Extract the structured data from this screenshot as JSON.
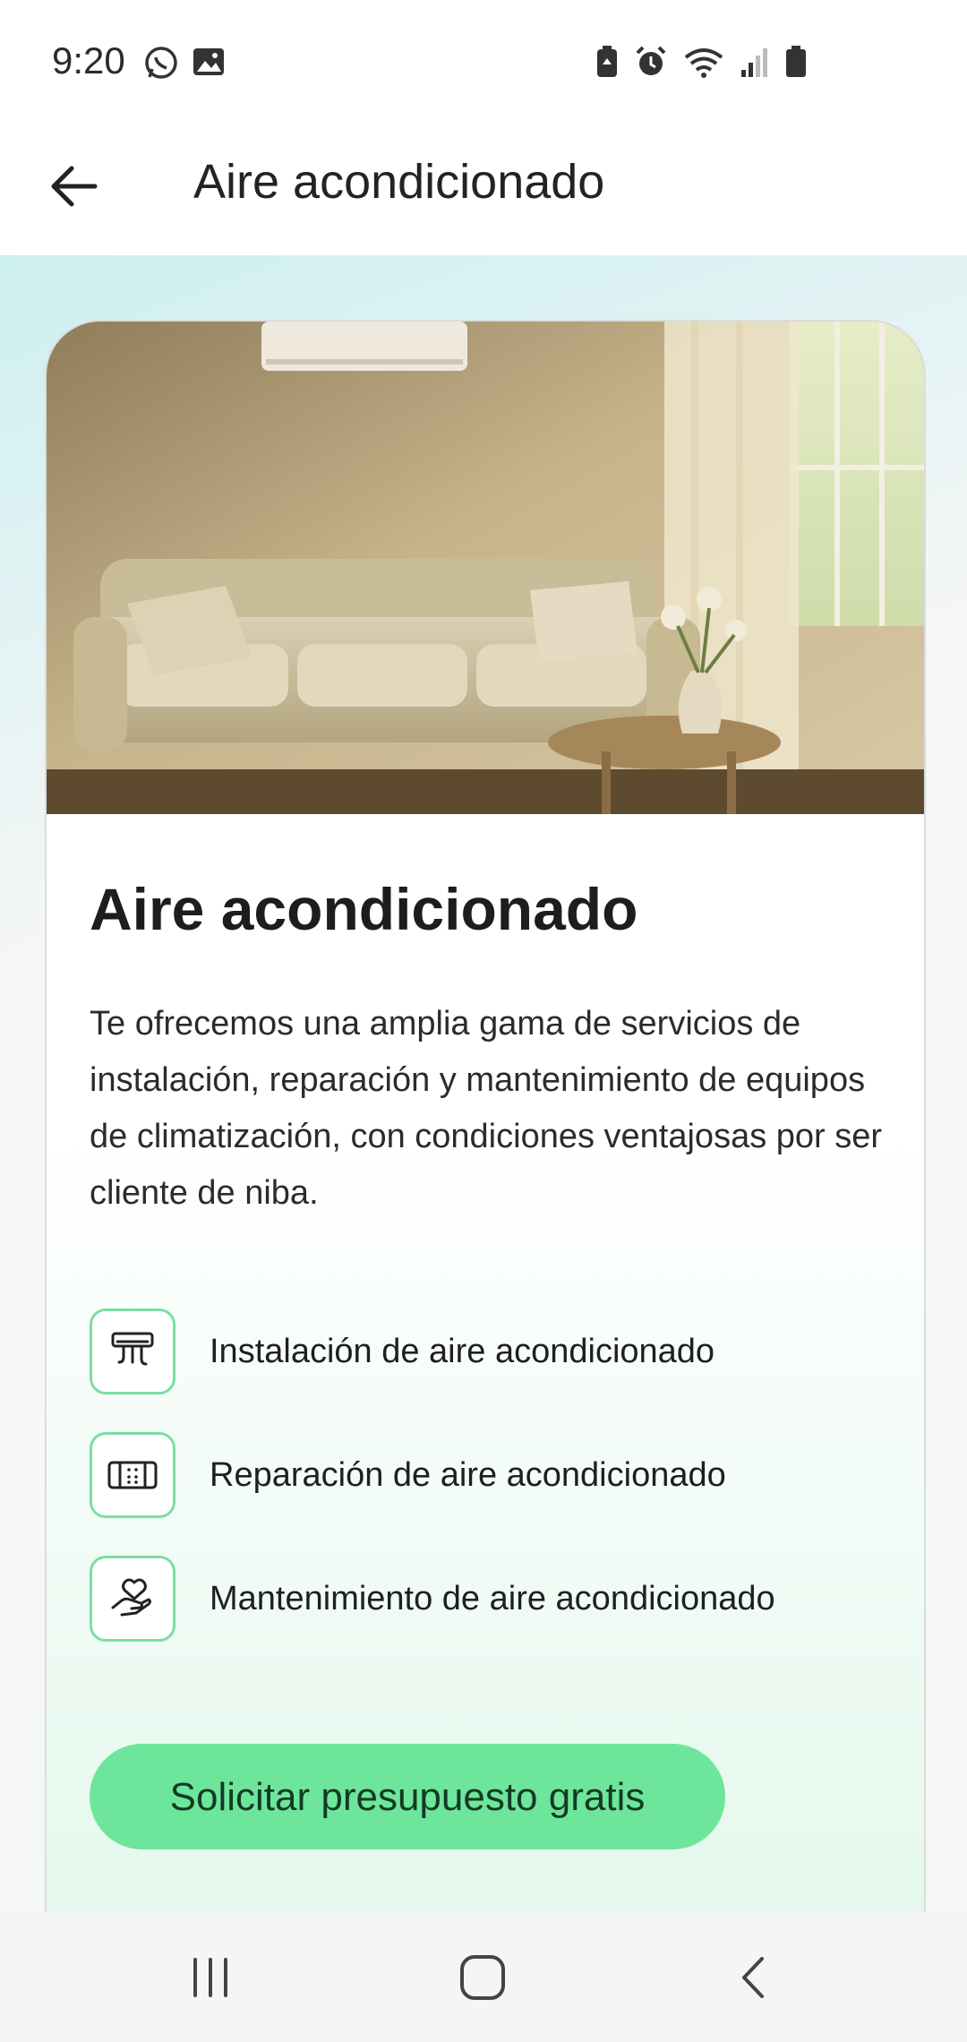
{
  "status_bar": {
    "time": "9:20",
    "icons_left": [
      "whatsapp-icon",
      "gallery-icon"
    ],
    "icons_right": [
      "battery-saver-icon",
      "alarm-icon",
      "wifi-icon",
      "signal-icon",
      "battery-icon"
    ]
  },
  "app_bar": {
    "title": "Aire acondicionado"
  },
  "card": {
    "title": "Aire acondicionado",
    "description": "Te ofrecemos una amplia gama de servicios de instalación, reparación y mantenimiento de equipos de climatización, con condiciones ventajosas por ser cliente de niba.",
    "features": [
      {
        "icon": "ac-unit-icon",
        "label": "Instalación de aire acondicionado"
      },
      {
        "icon": "ac-repair-icon",
        "label": "Reparación de aire acondicionado"
      },
      {
        "icon": "hand-heart-icon",
        "label": "Mantenimiento de aire acondicionado"
      }
    ],
    "cta_label": "Solicitar presupuesto gratis"
  },
  "colors": {
    "accent": "#6de69b",
    "icon_border": "#7adfa0"
  }
}
